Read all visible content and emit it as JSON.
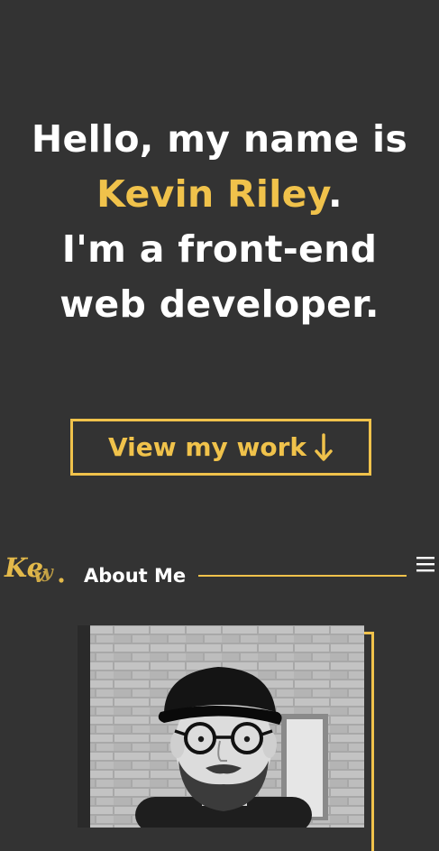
{
  "hero": {
    "greeting": "Hello, my name is",
    "name": "Kevin Riley",
    "name_punct": ".",
    "line3": "I'm a front-end",
    "line4": "web developer."
  },
  "cta": {
    "label": "View my work",
    "icon": "arrow-down-icon"
  },
  "header": {
    "logo_text": "Kev.",
    "menu_icon": "hamburger-menu-icon"
  },
  "about": {
    "title": "About Me"
  },
  "colors": {
    "background": "#333333",
    "accent": "#f0c24b",
    "text": "#ffffff"
  }
}
